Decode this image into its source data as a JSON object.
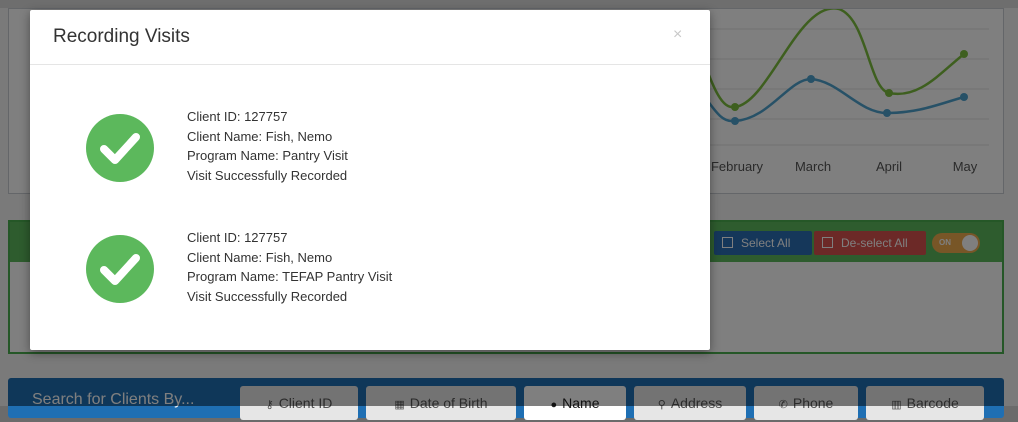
{
  "chart": {
    "months": [
      "February",
      "March",
      "April",
      "May"
    ]
  },
  "toolbar": {
    "select_all_label": "Select All",
    "deselect_all_label": "De-select All",
    "toggle_label": "ON"
  },
  "search": {
    "label": "Search for Clients By...",
    "tabs": [
      {
        "label": "Client ID",
        "icon": "key-icon"
      },
      {
        "label": "Date of Birth",
        "icon": "calendar-icon"
      },
      {
        "label": "Name",
        "icon": "user-icon"
      },
      {
        "label": "Address",
        "icon": "map-pin-icon"
      },
      {
        "label": "Phone",
        "icon": "phone-icon"
      },
      {
        "label": "Barcode",
        "icon": "barcode-icon"
      }
    ],
    "active_tab": "Name"
  },
  "modal": {
    "title": "Recording Visits",
    "close_label": "×",
    "visits": [
      {
        "client_id": "Client ID: 127757",
        "client_name": "Client Name: Fish, Nemo",
        "program_name": "Program Name: Pantry Visit",
        "status": "Visit Successfully Recorded"
      },
      {
        "client_id": "Client ID: 127757",
        "client_name": "Client Name: Fish, Nemo",
        "program_name": "Program Name: TEFAP Pantry Visit",
        "status": "Visit Successfully Recorded"
      }
    ]
  },
  "colors": {
    "success": "#5cb85c",
    "primary": "#1f6fb3",
    "danger": "#d9534f",
    "warning": "#f0ad4e"
  }
}
